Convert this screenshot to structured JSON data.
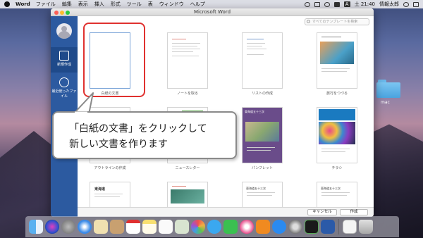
{
  "menubar": {
    "app_name": "Word",
    "items": [
      "ファイル",
      "編集",
      "表示",
      "挿入",
      "形式",
      "ツール",
      "表",
      "ウィンドウ",
      "ヘルプ"
    ],
    "clock": "土 21:40",
    "user": "情報太郎",
    "input_badge": "A"
  },
  "desktop": {
    "folder_label": "mac"
  },
  "window": {
    "title": "Microsoft Word",
    "search_placeholder": "すべてのテンプレートを検索",
    "sidebar": [
      {
        "label": "新規作成",
        "icon": "new-document-icon"
      },
      {
        "label": "最近使ったファイル",
        "icon": "clock-icon"
      }
    ],
    "templates": [
      {
        "name": "白紙の文書"
      },
      {
        "name": "ノートを取る"
      },
      {
        "name": "リストの作成"
      },
      {
        "name": "旅行をつづる"
      },
      {
        "name": "アウトラインの作成"
      },
      {
        "name": "ニュースレター"
      },
      {
        "name": "パンフレット"
      },
      {
        "name": "チラシ"
      },
      {
        "name": ""
      },
      {
        "name": ""
      },
      {
        "name": ""
      },
      {
        "name": ""
      }
    ],
    "thumb_text": {
      "pamphlet_title": "東海道五十三次",
      "row3_a": "東海道",
      "row3_c": "東海道五十三次",
      "row3_d": "東海道五十三次"
    },
    "buttons": {
      "cancel": "キャンセル",
      "create": "作成"
    }
  },
  "callout": {
    "line1": "「白紙の文書」をクリックして",
    "line2": "新しい文書を作ります"
  },
  "colors": {
    "accent": "#2c5aa0",
    "highlight": "#e0312f"
  }
}
